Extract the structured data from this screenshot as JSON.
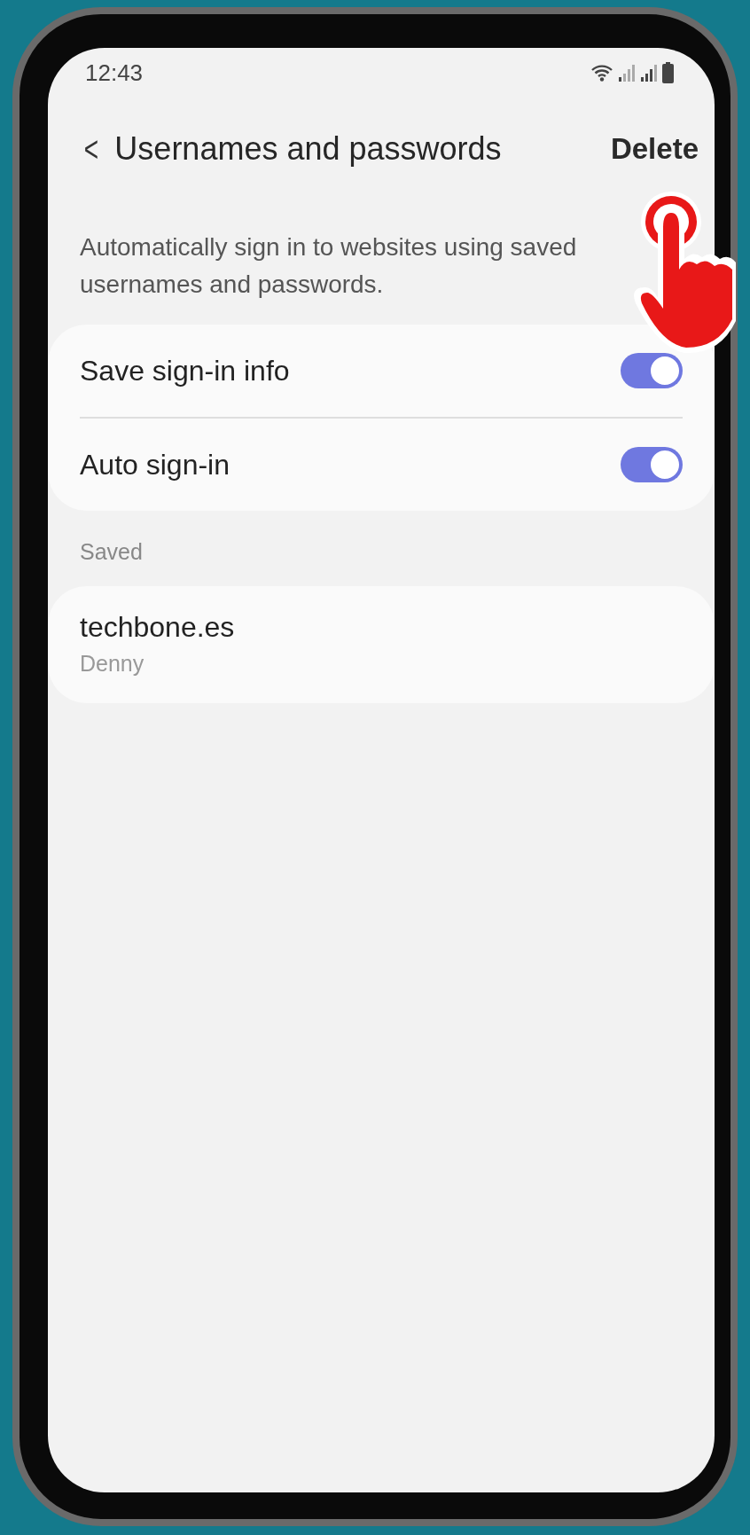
{
  "status_bar": {
    "time": "12:43"
  },
  "header": {
    "back": "<",
    "title": "Usernames and passwords",
    "action": "Delete"
  },
  "description": "Automatically sign in to websites using saved usernames and passwords.",
  "settings": [
    {
      "label": "Save sign-in info",
      "on": true
    },
    {
      "label": "Auto sign-in",
      "on": true
    }
  ],
  "saved": {
    "heading": "Saved",
    "entries": [
      {
        "site": "techbone.es",
        "username": "Denny"
      }
    ]
  }
}
